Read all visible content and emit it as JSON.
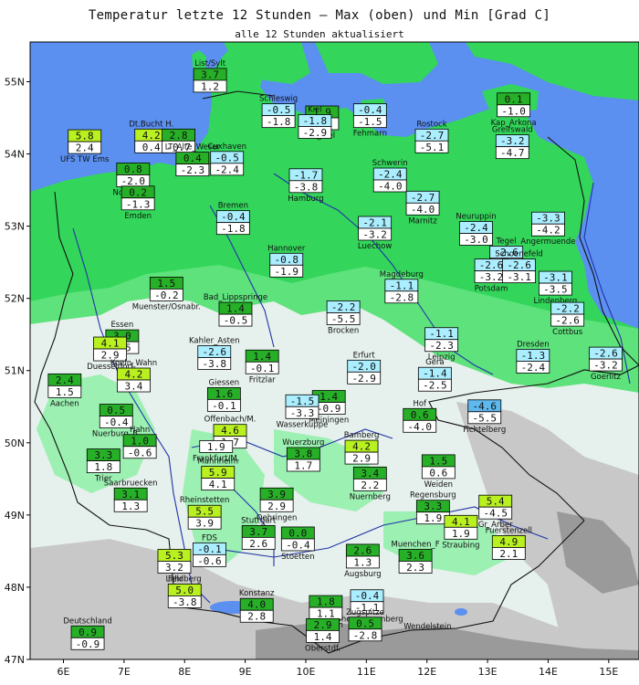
{
  "title": "Temperatur letzte 12 Stunden — Max (oben) und Min [Grad C]",
  "subtitle": "alle 12 Stunden aktualisiert",
  "axes": {
    "lat": [
      "55N",
      "54N",
      "53N",
      "52N",
      "51N",
      "50N",
      "49N",
      "48N",
      "47N"
    ],
    "lon": [
      "6E",
      "7E",
      "8E",
      "9E",
      "10E",
      "11E",
      "12E",
      "13E",
      "14E",
      "15E"
    ]
  },
  "colors": {
    "sea": "#5b8ff0",
    "lowland": "#33d65a",
    "green2": "#5ee27c",
    "green3": "#9cf0b2",
    "hill": "#e6f0ec",
    "mountain": "#c8c8c8",
    "high": "#9a9a9a",
    "river": "#2233aa",
    "border": "#111111",
    "max_pos": "#27b027",
    "max_warm": "#b8f020",
    "max_neg": "#aaeeff",
    "max_cold": "#5fb8ee"
  },
  "stations": [
    {
      "name": "List/Sylt",
      "lat": 55.02,
      "lon": 8.42,
      "max": "3.7",
      "min": "1.2"
    },
    {
      "name": "UFS TW Ems",
      "lat": 54.17,
      "lon": 6.35,
      "max": "5.8",
      "min": "2.4"
    },
    {
      "name": "Dt.Bucht H.",
      "lat": 54.18,
      "lon": 7.45,
      "max": "4.2",
      "min": "0.4"
    },
    {
      "name": "",
      "lat": 54.18,
      "lon": 7.9,
      "max": "2.8",
      "min": "-0.7"
    },
    {
      "name": "Cuxhaven",
      "lat": 53.87,
      "lon": 8.7,
      "max": "-0.5",
      "min": "-2.4"
    },
    {
      "name": "Norderney",
      "lat": 53.71,
      "lon": 7.15,
      "max": "0.8",
      "min": "-2.0"
    },
    {
      "name": "LT_Alte_Weser",
      "lat": 53.86,
      "lon": 8.13,
      "max": "0.4",
      "min": "-2.3"
    },
    {
      "name": "Emden",
      "lat": 53.39,
      "lon": 7.23,
      "max": "0.2",
      "min": "-1.3"
    },
    {
      "name": "Schleswig",
      "lat": 54.53,
      "lon": 9.55,
      "max": "-0.5",
      "min": "-1.8"
    },
    {
      "name": "LT_Kiel",
      "lat": 54.5,
      "lon": 10.27,
      "max": "1.9",
      "min": "0.3"
    },
    {
      "name": "Kiel",
      "lat": 54.38,
      "lon": 10.15,
      "max": "-1.8",
      "min": "-2.9"
    },
    {
      "name": "Fehmarn",
      "lat": 54.53,
      "lon": 11.06,
      "max": "-0.4",
      "min": "-1.5"
    },
    {
      "name": "Rostock",
      "lat": 54.18,
      "lon": 12.08,
      "max": "-2.7",
      "min": "-5.1"
    },
    {
      "name": "Kap_Arkona",
      "lat": 54.68,
      "lon": 13.43,
      "max": "0.1",
      "min": "-1.0"
    },
    {
      "name": "Greifswald",
      "lat": 54.1,
      "lon": 13.41,
      "max": "-3.2",
      "min": "-4.7"
    },
    {
      "name": "Hamburg",
      "lat": 53.63,
      "lon": 10.0,
      "max": "-1.7",
      "min": "-3.8"
    },
    {
      "name": "Schwerin",
      "lat": 53.64,
      "lon": 11.39,
      "max": "-2.4",
      "min": "-4.0"
    },
    {
      "name": "Marnitz",
      "lat": 53.32,
      "lon": 11.93,
      "max": "-2.7",
      "min": "-4.0"
    },
    {
      "name": "Bremen",
      "lat": 53.05,
      "lon": 8.8,
      "max": "-0.4",
      "min": "-1.8"
    },
    {
      "name": "Luechow",
      "lat": 52.97,
      "lon": 11.14,
      "max": "-2.1",
      "min": "-3.2"
    },
    {
      "name": "Neuruppin",
      "lat": 52.9,
      "lon": 12.81,
      "max": "-2.4",
      "min": "-3.0"
    },
    {
      "name": "Angermuende",
      "lat": 53.03,
      "lon": 14.0,
      "max": "-3.3",
      "min": "-4.2"
    },
    {
      "name": "Tegel",
      "lat": 52.56,
      "lon": 13.31,
      "max": "-2.6",
      "min": "-3.1"
    },
    {
      "name": "Potsdam",
      "lat": 52.38,
      "lon": 13.06,
      "max": "-2.6",
      "min": "-3.2"
    },
    {
      "name": "Schoenefeld",
      "lat": 52.38,
      "lon": 13.52,
      "max": "-2.6",
      "min": "-3.1"
    },
    {
      "name": "Lindenberg",
      "lat": 52.21,
      "lon": 14.12,
      "max": "-3.1",
      "min": "-3.5"
    },
    {
      "name": "Hannover",
      "lat": 52.46,
      "lon": 9.68,
      "max": "-0.8",
      "min": "-1.9"
    },
    {
      "name": "Muenster/Osnabr.",
      "lat": 52.13,
      "lon": 7.7,
      "max": "1.5",
      "min": "-0.2"
    },
    {
      "name": "Bad_Lippspringe",
      "lat": 51.78,
      "lon": 8.84,
      "max": "1.4",
      "min": "-0.5"
    },
    {
      "name": "Brocken",
      "lat": 51.8,
      "lon": 10.62,
      "max": "-2.2",
      "min": "-5.5"
    },
    {
      "name": "Magdeburg",
      "lat": 52.1,
      "lon": 11.58,
      "max": "-1.1",
      "min": "-2.8"
    },
    {
      "name": "Cottbus",
      "lat": 51.78,
      "lon": 14.32,
      "max": "-2.2",
      "min": "-2.6"
    },
    {
      "name": "Essen",
      "lat": 51.4,
      "lon": 6.97,
      "max": "3.0",
      "min": "1.5"
    },
    {
      "name": "Duesseldorf",
      "lat": 51.3,
      "lon": 6.77,
      "max": "4.1",
      "min": "2.9"
    },
    {
      "name": "Kahler_Asten",
      "lat": 51.18,
      "lon": 8.49,
      "max": "-2.6",
      "min": "-3.8"
    },
    {
      "name": "Fritzlar",
      "lat": 51.12,
      "lon": 9.28,
      "max": "1.4",
      "min": "-0.1"
    },
    {
      "name": "Erfurt",
      "lat": 50.98,
      "lon": 10.96,
      "max": "-2.0",
      "min": "-2.9"
    },
    {
      "name": "Leipzig",
      "lat": 51.43,
      "lon": 12.24,
      "max": "-1.1",
      "min": "-2.3"
    },
    {
      "name": "Dresden",
      "lat": 51.13,
      "lon": 13.75,
      "max": "-1.3",
      "min": "-2.4"
    },
    {
      "name": "Goerlitz",
      "lat": 51.16,
      "lon": 14.95,
      "max": "-2.6",
      "min": "-3.2"
    },
    {
      "name": "Koeln_Wahn",
      "lat": 50.87,
      "lon": 7.16,
      "max": "4.2",
      "min": "3.4"
    },
    {
      "name": "Aachen",
      "lat": 50.79,
      "lon": 6.02,
      "max": "2.4",
      "min": "1.5"
    },
    {
      "name": "Giessen",
      "lat": 50.6,
      "lon": 8.65,
      "max": "1.6",
      "min": "-0.1"
    },
    {
      "name": "Meiningen",
      "lat": 50.56,
      "lon": 10.38,
      "max": "1.4",
      "min": "-0.9"
    },
    {
      "name": "Gera",
      "lat": 50.88,
      "lon": 12.13,
      "max": "-1.4",
      "min": "-2.5"
    },
    {
      "name": "Nuerburg_B.",
      "lat": 50.37,
      "lon": 6.87,
      "max": "0.5",
      "min": "-0.4"
    },
    {
      "name": "Offenbach/M.",
      "lat": 50.09,
      "lon": 8.75,
      "max": "4.6",
      "min": "1.7"
    },
    {
      "name": "Wasserkuppe",
      "lat": 50.5,
      "lon": 9.94,
      "max": "-1.5",
      "min": "-3.3"
    },
    {
      "name": "Hof",
      "lat": 50.31,
      "lon": 11.88,
      "max": "0.6",
      "min": "-4.0"
    },
    {
      "name": "Fichtelberg",
      "lat": 50.43,
      "lon": 12.95,
      "max": "-4.6",
      "min": "-5.5"
    },
    {
      "name": "Hahn",
      "lat": 49.95,
      "lon": 7.26,
      "max": "1.0",
      "min": "-0.6"
    },
    {
      "name": "Frankfurt/M.",
      "lat": 50.03,
      "lon": 8.52,
      "max": "",
      "min": "1.9"
    },
    {
      "name": "Bamberg",
      "lat": 49.87,
      "lon": 10.92,
      "max": "4.2",
      "min": "2.9"
    },
    {
      "name": "Trier",
      "lat": 49.75,
      "lon": 6.66,
      "max": "3.3",
      "min": "1.8"
    },
    {
      "name": "Wuerzburg",
      "lat": 49.77,
      "lon": 9.96,
      "max": "3.8",
      "min": "1.7"
    },
    {
      "name": "Weiden",
      "lat": 49.67,
      "lon": 12.19,
      "max": "1.5",
      "min": "0.6"
    },
    {
      "name": "Mannheim",
      "lat": 49.51,
      "lon": 8.55,
      "max": "5.9",
      "min": "4.1"
    },
    {
      "name": "Nuernberg",
      "lat": 49.5,
      "lon": 11.06,
      "max": "3.4",
      "min": "2.2"
    },
    {
      "name": "Saarbruecken",
      "lat": 49.21,
      "lon": 7.11,
      "max": "3.1",
      "min": "1.3"
    },
    {
      "name": "Oehringen",
      "lat": 49.21,
      "lon": 9.52,
      "max": "3.9",
      "min": "2.9"
    },
    {
      "name": "Regensburg",
      "lat": 49.04,
      "lon": 12.1,
      "max": "3.3",
      "min": "1.9"
    },
    {
      "name": "Gr_Arber",
      "lat": 49.11,
      "lon": 13.13,
      "max": "5.4",
      "min": "-4.5"
    },
    {
      "name": "Rheinstetten",
      "lat": 48.97,
      "lon": 8.33,
      "max": "5.5",
      "min": "3.9"
    },
    {
      "name": "Straubing",
      "lat": 48.83,
      "lon": 12.56,
      "max": "4.1",
      "min": "1.9"
    },
    {
      "name": "Stuttgart",
      "lat": 48.69,
      "lon": 9.22,
      "max": "3.7",
      "min": "2.6"
    },
    {
      "name": "Stoetten",
      "lat": 48.67,
      "lon": 9.87,
      "max": "0.0",
      "min": "-0.4"
    },
    {
      "name": "Fuerstenzell",
      "lat": 48.55,
      "lon": 13.35,
      "max": "4.9",
      "min": "2.1"
    },
    {
      "name": "Lahr",
      "lat": 48.36,
      "lon": 7.83,
      "max": "5.3",
      "min": "3.2"
    },
    {
      "name": "FDS",
      "lat": 48.45,
      "lon": 8.41,
      "max": "-0.1",
      "min": "-0.6"
    },
    {
      "name": "Augsburg",
      "lat": 48.43,
      "lon": 10.94,
      "max": "2.6",
      "min": "1.3"
    },
    {
      "name": "Muenchen_F",
      "lat": 48.36,
      "lon": 11.81,
      "max": "3.6",
      "min": "2.3"
    },
    {
      "name": "Hohenpeissenberg",
      "lat": 47.8,
      "lon": 11.01,
      "max": "-0.4",
      "min": "-1.1"
    },
    {
      "name": "Feldberg",
      "lat": 47.88,
      "lon": 8.0,
      "max": "5.0",
      "min": "-3.8"
    },
    {
      "name": "Kempten",
      "lat": 47.72,
      "lon": 10.33,
      "max": "1.8",
      "min": "1.1"
    },
    {
      "name": "Konstanz",
      "lat": 47.68,
      "lon": 9.19,
      "max": "4.0",
      "min": "2.8"
    },
    {
      "name": "Oberstdf.",
      "lat": 47.4,
      "lon": 10.28,
      "max": "2.9",
      "min": "1.4"
    },
    {
      "name": "Zugspitze",
      "lat": 47.42,
      "lon": 10.98,
      "max": "0.5",
      "min": "-2.8"
    },
    {
      "name": "Wendelstein",
      "lat": 47.7,
      "lon": 12.01,
      "max": "",
      "min": ""
    },
    {
      "name": "Deutschland",
      "lat": 47.3,
      "lon": 6.4,
      "max": "0.9",
      "min": "-0.9"
    }
  ]
}
